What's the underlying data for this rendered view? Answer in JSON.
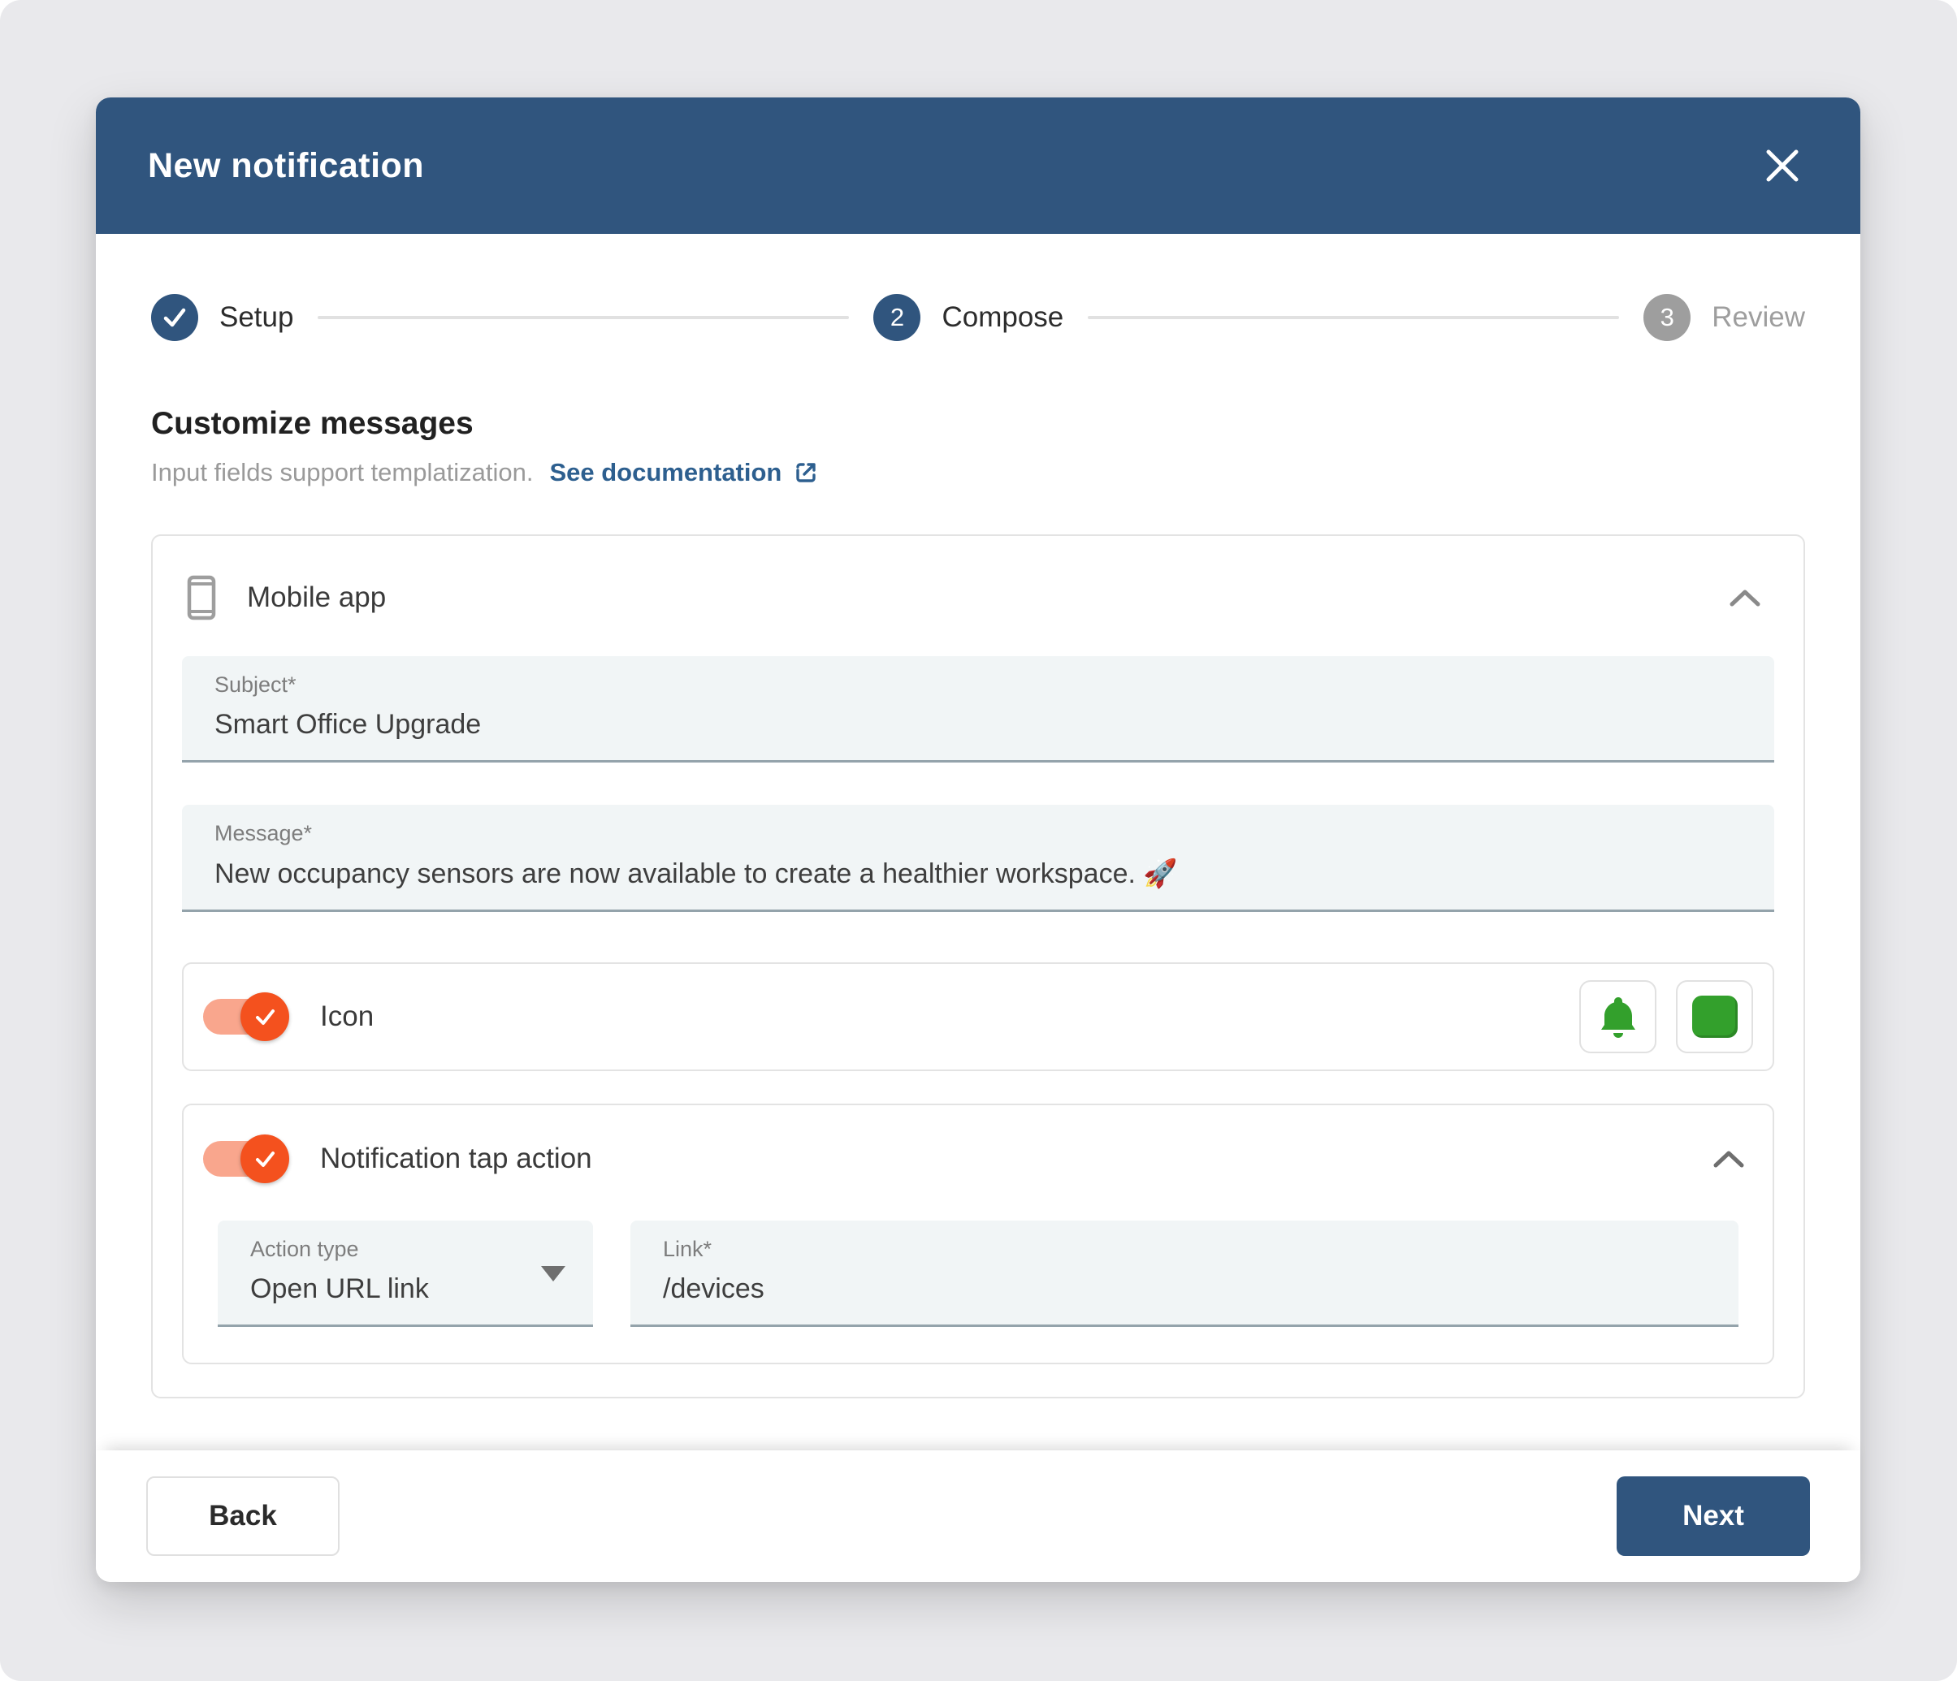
{
  "modal": {
    "title": "New notification"
  },
  "stepper": {
    "steps": [
      {
        "label": "Setup",
        "indicator": "check",
        "state": "complete"
      },
      {
        "label": "Compose",
        "indicator": "2",
        "state": "active"
      },
      {
        "label": "Review",
        "indicator": "3",
        "state": "upcoming"
      }
    ]
  },
  "section": {
    "heading": "Customize messages",
    "subtext": "Input fields support templatization.",
    "doc_link": "See documentation"
  },
  "mobile_app": {
    "title": "Mobile app",
    "subject": {
      "label": "Subject*",
      "value": "Smart Office Upgrade"
    },
    "message": {
      "label": "Message*",
      "value": "New occupancy sensors are now available to create a healthier workspace. 🚀"
    },
    "icon_toggle": {
      "label": "Icon",
      "enabled": true
    },
    "tap_action": {
      "label": "Notification tap action",
      "enabled": true,
      "action_type": {
        "label": "Action type",
        "value": "Open URL link"
      },
      "link": {
        "label": "Link*",
        "value": "/devices"
      }
    }
  },
  "footer": {
    "back_label": "Back",
    "next_label": "Next"
  },
  "colors": {
    "primary_blue": "#30557e",
    "link_blue": "#2d5f8f",
    "toggle_track_orange": "#f9a68d",
    "toggle_thumb_orange": "#f4511e",
    "icon_green": "#33a02c",
    "inactive_gray": "#9e9e9e"
  }
}
